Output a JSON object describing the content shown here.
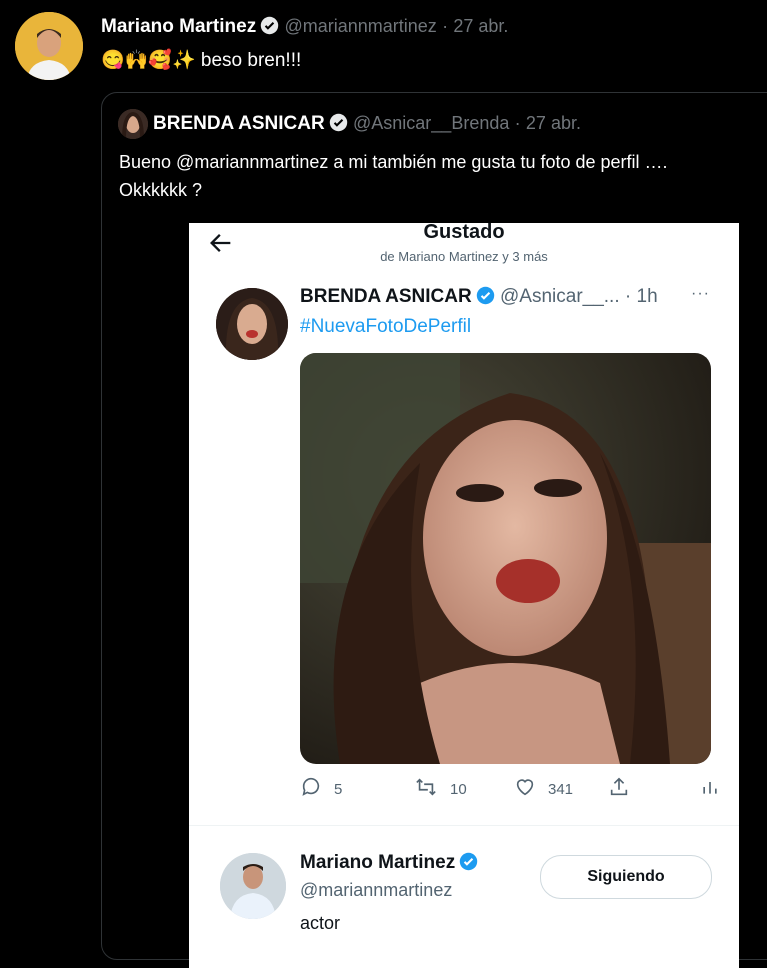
{
  "outer_tweet": {
    "author_name": "Mariano Martinez",
    "handle": "@mariannmartinez",
    "separator": "·",
    "date": "27 abr.",
    "emojis": "😋🙌🥰✨",
    "text": "beso bren!!!"
  },
  "quoted_tweet": {
    "author_name": "BRENDA ASNICAR",
    "handle": "@Asnicar__Brenda",
    "separator": "·",
    "date": "27 abr.",
    "text_line1": "Bueno @mariannmartinez a mi también me gusta tu foto de perfil ….",
    "text_line2": "Okkkkkk ?"
  },
  "screenshot": {
    "header_title": "Gustado",
    "header_subtitle": "de Mariano Martinez y 3 más",
    "tweet": {
      "author_name": "BRENDA ASNICAR",
      "handle": "@Asnicar__...",
      "separator": "·",
      "time": "1h",
      "more": "···",
      "hashtag": "#NuevaFotoDePerfil",
      "replies": "5",
      "retweets": "10",
      "likes": "341"
    },
    "profile": {
      "name": "Mariano Martinez",
      "handle": "@mariannmartinez",
      "bio": "actor",
      "follow_label": "Siguiendo"
    }
  },
  "colors": {
    "accent": "#1d9bf0",
    "background": "#000000",
    "card": "#ffffff"
  }
}
